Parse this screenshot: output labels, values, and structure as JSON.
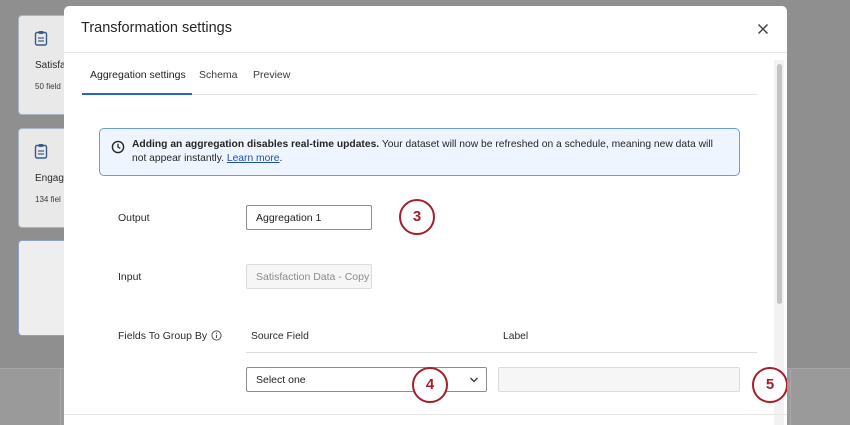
{
  "background": {
    "cards": [
      {
        "title": "Satisfa",
        "subtitle": "50 field"
      },
      {
        "title": "Engag",
        "subtitle": "134 fiel"
      }
    ]
  },
  "modal": {
    "title": "Transformation settings",
    "close_icon": "close-icon",
    "tabs": [
      {
        "label": "Aggregation settings",
        "active": true
      },
      {
        "label": "Schema",
        "active": false
      },
      {
        "label": "Preview",
        "active": false
      }
    ],
    "alert": {
      "icon": "clock-icon",
      "bold_text": "Adding an aggregation disables real-time updates.",
      "text": " Your dataset will now be refreshed on a schedule, meaning new data will not appear instantly. ",
      "link_text": "Learn more",
      "trailing": "."
    },
    "output": {
      "label": "Output",
      "value": "Aggregation 1"
    },
    "input": {
      "label": "Input",
      "value": "Satisfaction Data - Copy"
    },
    "group_by": {
      "label": "Fields To Group By",
      "info_icon": "info-icon",
      "columns": {
        "source": "Source Field",
        "label": "Label"
      },
      "select_value": "Select one",
      "label_value": ""
    },
    "badges": [
      "3",
      "4",
      "5"
    ]
  },
  "colors": {
    "accent": "#2b64c8",
    "alert_border": "#6e9ad6",
    "alert_bg": "#eef5ff",
    "badge": "#a51f2a"
  }
}
